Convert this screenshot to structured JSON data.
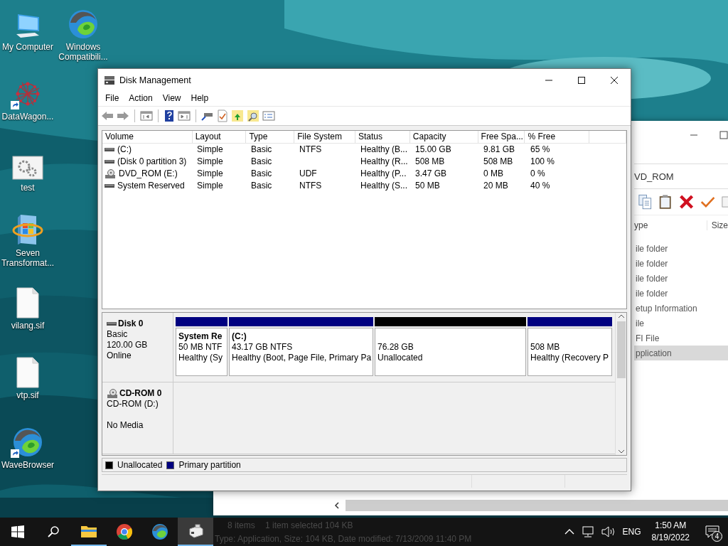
{
  "desktop_icons": [
    {
      "label": "My Computer",
      "kind": "computer",
      "shortcut": false
    },
    {
      "label": "DataWagon...",
      "kind": "network",
      "shortcut": true
    },
    {
      "label": "test",
      "kind": "gears",
      "shortcut": false
    },
    {
      "label": "Seven Transformat...",
      "kind": "setup",
      "shortcut": false
    },
    {
      "label": "vilang.sif",
      "kind": "file",
      "shortcut": false
    },
    {
      "label": "vtp.sif",
      "kind": "file",
      "shortcut": false
    },
    {
      "label": "WaveBrowser",
      "kind": "wave",
      "shortcut": true
    },
    {
      "label": "Windows Compatibili...",
      "kind": "wave",
      "shortcut": false
    }
  ],
  "explorer_window": {
    "address": "VD_ROM",
    "columns": [
      "ype",
      "Size"
    ],
    "rows": [
      {
        "type": "ile folder",
        "selected": false
      },
      {
        "type": "ile folder",
        "selected": false
      },
      {
        "type": "ile folder",
        "selected": false
      },
      {
        "type": "ile folder",
        "selected": false
      },
      {
        "type": "etup Information",
        "selected": false
      },
      {
        "type": "ile",
        "selected": false
      },
      {
        "type": "FI File",
        "selected": false
      },
      {
        "type": "pplication",
        "selected": true
      }
    ],
    "status": [
      "8 items",
      "1 item selected  104 KB",
      "Type: Application, Size: 104 KB, Date modified: 7/13/2009 11:40 PM"
    ]
  },
  "window": {
    "title": "Disk Management"
  },
  "menu": [
    "File",
    "Action",
    "View",
    "Help"
  ],
  "volume_table": {
    "columns": [
      "Volume",
      "Layout",
      "Type",
      "File System",
      "Status",
      "Capacity",
      "Free Spa...",
      "% Free"
    ],
    "rows": [
      {
        "kind": "disk",
        "cells": [
          "(C:)",
          "Simple",
          "Basic",
          "NTFS",
          "Healthy (B...",
          "15.00 GB",
          "9.81 GB",
          "65 %"
        ]
      },
      {
        "kind": "disk",
        "cells": [
          "(Disk 0 partition 3)",
          "Simple",
          "Basic",
          "",
          "Healthy (R...",
          "508 MB",
          "508 MB",
          "100 %"
        ]
      },
      {
        "kind": "cdrom",
        "cells": [
          "DVD_ROM (E:)",
          "Simple",
          "Basic",
          "UDF",
          "Healthy (P...",
          "3.47 GB",
          "0 MB",
          "0 %"
        ]
      },
      {
        "kind": "disk",
        "cells": [
          "System Reserved",
          "Simple",
          "Basic",
          "NTFS",
          "Healthy (S...",
          "50 MB",
          "20 MB",
          "40 %"
        ]
      }
    ]
  },
  "disks": [
    {
      "kind": "disk",
      "name": "Disk 0",
      "type": "Basic",
      "size": "120.00 GB",
      "status": "Online",
      "partitions": [
        {
          "kind": "primary",
          "title": "System Re",
          "lines": [
            "50 MB NTF",
            "Healthy (Sy"
          ]
        },
        {
          "kind": "primary",
          "title": "(C:)",
          "lines": [
            "43.17 GB NTFS",
            "Healthy (Boot, Page File, Primary Pa"
          ]
        },
        {
          "kind": "unallocated",
          "lines": [
            "76.28 GB",
            "Unallocated"
          ]
        },
        {
          "kind": "primary",
          "lines": [
            "508 MB",
            "Healthy (Recovery P"
          ]
        }
      ]
    },
    {
      "kind": "cdrom",
      "name": "CD-ROM 0",
      "type": "CD-ROM (D:)",
      "status": "No Media"
    }
  ],
  "legend": [
    {
      "label": "Unallocated",
      "color": "#000000"
    },
    {
      "label": "Primary partition",
      "color": "#000080"
    }
  ],
  "taskbar": {
    "apps": [
      {
        "kind": "explorer",
        "running": true,
        "selected": false
      },
      {
        "kind": "chrome",
        "running": false,
        "selected": false
      },
      {
        "kind": "wave",
        "running": false,
        "selected": false
      },
      {
        "kind": "disk",
        "running": true,
        "selected": true
      }
    ],
    "language": "ENG",
    "time": "1:50 AM",
    "date": "8/19/2022",
    "notifications": "4"
  }
}
